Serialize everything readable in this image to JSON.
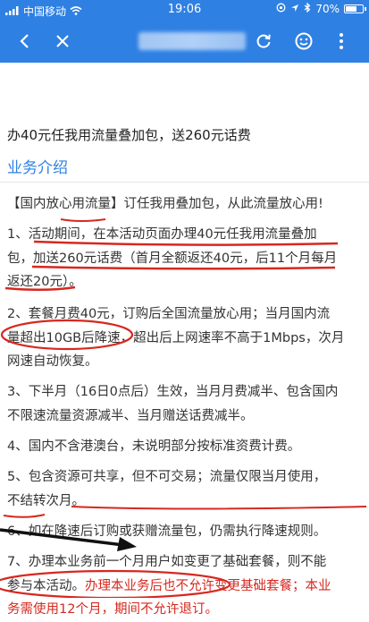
{
  "status_bar": {
    "carrier": "中国移动",
    "time": "19:06",
    "battery": "70%",
    "battery_level": 0.7
  },
  "nav": {
    "back_icon": "chevron-left-icon",
    "close_icon": "close-icon",
    "refresh_icon": "refresh-icon",
    "smiley_icon": "smiley-icon",
    "more_icon": "more-vertical-icon"
  },
  "article": {
    "title": "办40元任我用流量叠加包，送260元话费",
    "section_heading": "业务介绍",
    "intro": "【国内放心用流量】订任我用叠加包，从此流量放心用!",
    "p1": [
      "1、活动期间，在本活动页面办理40元任我用流量叠加",
      "包，加送260元话费（首月全额返还40元，后11个月每月",
      "返还20元）。"
    ],
    "p2": [
      "2、套餐月费40元，订购后全国流量放心用；当月国内流",
      "量超出10GB后降速，超出后上网速率不高于1Mbps，次月",
      "网速自动恢复。"
    ],
    "p3": [
      "3、下半月（16日0点后）生效，当月月费减半、包含国内",
      "不限速流量资源减半、当月赠送话费减半。"
    ],
    "p4": "4、国内不含港澳台，未说明部分按标准资费计费。",
    "p5": [
      "5、包含资源可共享，但不可交易；流量仅限当月使用，",
      "不结转次月。"
    ],
    "p6": "6、如在降速后订购或获赠流量包，仍需执行降速规则。",
    "p7_a": "7、办理本业务前一个月用户如变更了基础套餐，则不能",
    "p7_b1": "参与本活动。",
    "p7_b2": "办理本业务后也不允许变更基础套餐；本业",
    "p7_c": "务需使用12个月，期间不允许退订。"
  }
}
